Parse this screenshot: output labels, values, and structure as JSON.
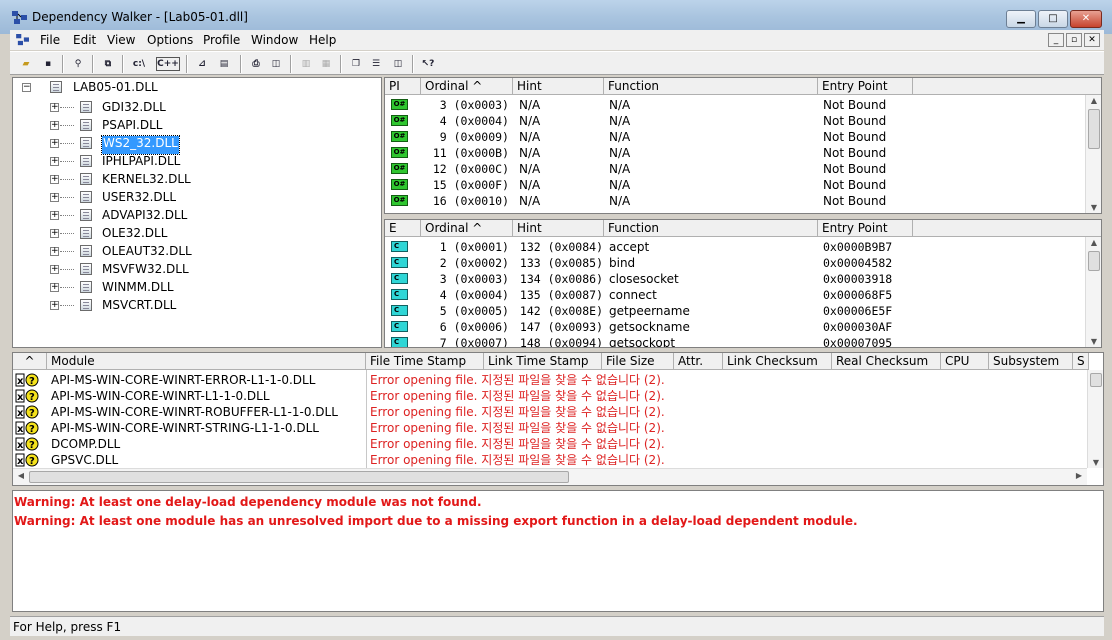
{
  "window": {
    "title": "Dependency Walker - [Lab05-01.dll]",
    "caption_buttons": [
      "minimize",
      "maximize",
      "close"
    ]
  },
  "menu": {
    "items": [
      "File",
      "Edit",
      "View",
      "Options",
      "Profile",
      "Window",
      "Help"
    ]
  },
  "toolbar": {
    "buttons": [
      "open-icon",
      "save-icon",
      "find-icon",
      "copy-icon",
      "full-path-label",
      "cplus-label",
      "graph-icon",
      "properties-icon",
      "print-icon",
      "view-icon",
      "module-icon",
      "disabled-icon",
      "disabled-icon",
      "cascade-icon",
      "tile-horizontal-icon",
      "tile-vertical-icon",
      "help-icon"
    ],
    "labels": {
      "path": "c:\\",
      "cpp": "C++"
    }
  },
  "tree": {
    "root": "LAB05-01.DLL",
    "children": [
      "GDI32.DLL",
      "PSAPI.DLL",
      "WS2_32.DLL",
      "IPHLPAPI.DLL",
      "KERNEL32.DLL",
      "USER32.DLL",
      "ADVAPI32.DLL",
      "OLE32.DLL",
      "OLEAUT32.DLL",
      "MSVFW32.DLL",
      "WINMM.DLL",
      "MSVCRT.DLL"
    ],
    "selected": "WS2_32.DLL"
  },
  "import_table": {
    "headers": [
      "PI",
      "Ordinal ^",
      "Hint",
      "Function",
      "Entry Point"
    ],
    "rows": [
      {
        "ordinal": "3 (0x0003)",
        "hint": "N/A",
        "function": "N/A",
        "entry": "Not Bound"
      },
      {
        "ordinal": "4 (0x0004)",
        "hint": "N/A",
        "function": "N/A",
        "entry": "Not Bound"
      },
      {
        "ordinal": "9 (0x0009)",
        "hint": "N/A",
        "function": "N/A",
        "entry": "Not Bound"
      },
      {
        "ordinal": "11 (0x000B)",
        "hint": "N/A",
        "function": "N/A",
        "entry": "Not Bound"
      },
      {
        "ordinal": "12 (0x000C)",
        "hint": "N/A",
        "function": "N/A",
        "entry": "Not Bound"
      },
      {
        "ordinal": "15 (0x000F)",
        "hint": "N/A",
        "function": "N/A",
        "entry": "Not Bound"
      },
      {
        "ordinal": "16 (0x0010)",
        "hint": "N/A",
        "function": "N/A",
        "entry": "Not Bound"
      }
    ],
    "pi_badge": "O#"
  },
  "export_table": {
    "headers": [
      "E",
      "Ordinal ^",
      "Hint",
      "Function",
      "Entry Point"
    ],
    "rows": [
      {
        "ordinal": "1 (0x0001)",
        "hint": "132 (0x0084)",
        "function": "accept",
        "entry": "0x0000B9B7"
      },
      {
        "ordinal": "2 (0x0002)",
        "hint": "133 (0x0085)",
        "function": "bind",
        "entry": "0x00004582"
      },
      {
        "ordinal": "3 (0x0003)",
        "hint": "134 (0x0086)",
        "function": "closesocket",
        "entry": "0x00003918"
      },
      {
        "ordinal": "4 (0x0004)",
        "hint": "135 (0x0087)",
        "function": "connect",
        "entry": "0x000068F5"
      },
      {
        "ordinal": "5 (0x0005)",
        "hint": "142 (0x008E)",
        "function": "getpeername",
        "entry": "0x00006E5F"
      },
      {
        "ordinal": "6 (0x0006)",
        "hint": "147 (0x0093)",
        "function": "getsockname",
        "entry": "0x000030AF"
      },
      {
        "ordinal": "7 (0x0007)",
        "hint": "148 (0x0094)",
        "function": "getsockopt",
        "entry": "0x00007095"
      }
    ],
    "e_badge": "C"
  },
  "module_list": {
    "headers": [
      "^",
      "Module",
      "File Time Stamp",
      "Link Time Stamp",
      "File Size",
      "Attr.",
      "Link Checksum",
      "Real Checksum",
      "CPU",
      "Subsystem",
      "S"
    ],
    "rows": [
      {
        "module": "API-MS-WIN-CORE-WINRT-ERROR-L1-1-0.DLL",
        "error": "Error opening file. 지정된 파일을 찾을 수 없습니다 (2)."
      },
      {
        "module": "API-MS-WIN-CORE-WINRT-L1-1-0.DLL",
        "error": "Error opening file. 지정된 파일을 찾을 수 없습니다 (2)."
      },
      {
        "module": "API-MS-WIN-CORE-WINRT-ROBUFFER-L1-1-0.DLL",
        "error": "Error opening file. 지정된 파일을 찾을 수 없습니다 (2)."
      },
      {
        "module": "API-MS-WIN-CORE-WINRT-STRING-L1-1-0.DLL",
        "error": "Error opening file. 지정된 파일을 찾을 수 없습니다 (2)."
      },
      {
        "module": "DCOMP.DLL",
        "error": "Error opening file. 지정된 파일을 찾을 수 없습니다 (2)."
      },
      {
        "module": "GPSVC.DLL",
        "error": "Error opening file. 지정된 파일을 찾을 수 없습니다 (2)."
      }
    ]
  },
  "log": {
    "lines": [
      "Warning: At least one delay-load dependency module was not found.",
      "Warning: At least one module has an unresolved import due to a missing export function in a delay-load dependent module."
    ]
  },
  "status": {
    "text": "For Help, press F1"
  },
  "colors": {
    "warning": "#e21818",
    "selection": "#3399ff",
    "pi_green": "#2fc62f",
    "e_cyan": "#2fd6d6"
  }
}
